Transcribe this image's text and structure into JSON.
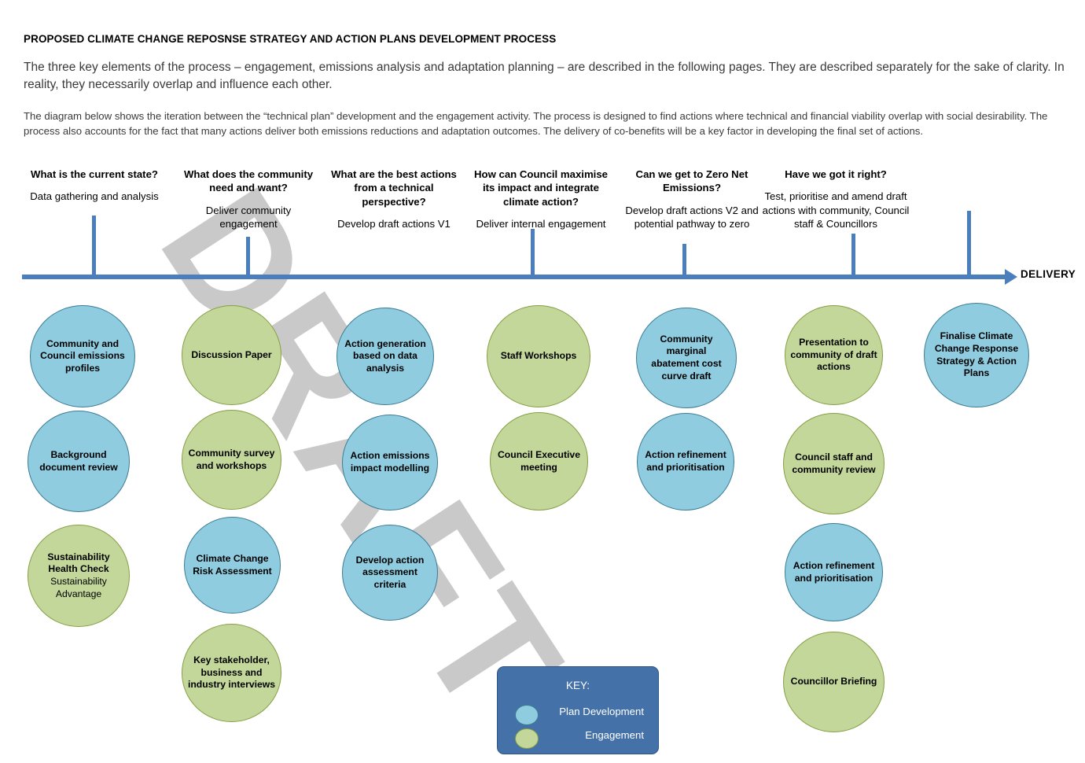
{
  "document": {
    "title": "PROPOSED CLIMATE CHANGE REPOSNSE STRATEGY AND ACTION PLANS DEVELOPMENT PROCESS",
    "paragraph_1": "The three key elements of the process – engagement, emissions analysis and adaptation planning – are described in the following pages. They are described separately for the sake of clarity. In reality, they necessarily overlap and influence each other.",
    "paragraph_2": "The diagram below shows the iteration between the “technical plan” development and the engagement activity. The process is designed to find actions where technical and financial viability overlap with social desirability. The process also accounts for the fact that many actions deliver both emissions reductions and adaptation outcomes. The delivery of co-benefits will be a key factor in developing the final set of actions.",
    "watermark": "DRAFT"
  },
  "timeline": {
    "end_label": "DELIVERY",
    "axis_color": "#4A7EBC",
    "stages": [
      {
        "question": "What is the current state?",
        "activity": "Data gathering and analysis"
      },
      {
        "question": "What does the community need and want?",
        "activity": "Deliver community engagement"
      },
      {
        "question": "What are the best actions from a technical perspective?",
        "activity": "Develop draft actions V1"
      },
      {
        "question": "How can Council maximise its impact and integrate climate action?",
        "activity": "Deliver internal engagement"
      },
      {
        "question": "Can we get to Zero Net Emissions?",
        "activity": "Develop draft actions V2 and potential pathway to zero"
      },
      {
        "question": "Have we got it right?",
        "activity": "Test, prioritise and amend draft actions with community, Council staff & Councillors"
      }
    ]
  },
  "columns": [
    {
      "bubbles": [
        {
          "label": "Community and Council emissions profiles",
          "type": "plan"
        },
        {
          "label": "Background document review",
          "type": "plan"
        },
        {
          "label": "Sustainability Health Check",
          "sub_label": "Sustainability Advantage",
          "type": "engagement"
        }
      ]
    },
    {
      "bubbles": [
        {
          "label": "Discussion Paper",
          "type": "engagement"
        },
        {
          "label": "Community survey and workshops",
          "type": "engagement"
        },
        {
          "label": "Climate Change Risk Assessment",
          "type": "plan"
        },
        {
          "label": "Key stakeholder, business and industry interviews",
          "type": "engagement"
        }
      ]
    },
    {
      "bubbles": [
        {
          "label": "Action generation based on data analysis",
          "type": "plan"
        },
        {
          "label": "Action emissions impact modelling",
          "type": "plan"
        },
        {
          "label": "Develop action assessment criteria",
          "type": "plan"
        }
      ]
    },
    {
      "bubbles": [
        {
          "label": "Staff Workshops",
          "type": "engagement"
        },
        {
          "label": "Council Executive meeting",
          "type": "engagement"
        }
      ]
    },
    {
      "bubbles": [
        {
          "label": "Community marginal abatement cost curve draft",
          "type": "plan"
        },
        {
          "label": "Action refinement and prioritisation",
          "type": "plan"
        }
      ]
    },
    {
      "bubbles": [
        {
          "label": "Presentation to community of draft actions",
          "type": "engagement"
        },
        {
          "label": "Council staff and community review",
          "type": "engagement"
        },
        {
          "label": "Action refinement and prioritisation",
          "type": "plan"
        },
        {
          "label": "Councillor Briefing",
          "type": "engagement"
        }
      ]
    },
    {
      "bubbles": [
        {
          "label": "Finalise Climate Change Response Strategy & Action Plans",
          "type": "plan"
        }
      ]
    }
  ],
  "key": {
    "title": "KEY:",
    "items": [
      {
        "label": "Plan Development",
        "type": "plan",
        "color": "#8FCCE0"
      },
      {
        "label": "Engagement",
        "type": "engagement",
        "color": "#C3D79B"
      }
    ]
  }
}
